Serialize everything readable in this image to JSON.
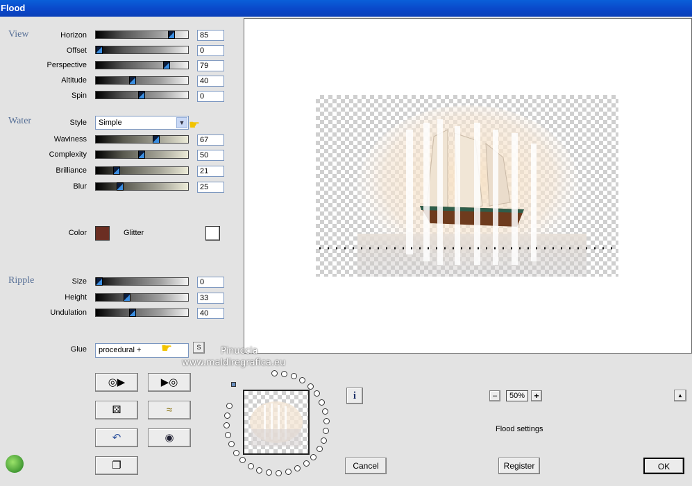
{
  "window": {
    "title": "Flood"
  },
  "sections": {
    "view": "View",
    "water": "Water",
    "ripple": "Ripple"
  },
  "view": {
    "horizon": {
      "label": "Horizon",
      "value": "85"
    },
    "offset": {
      "label": "Offset",
      "value": "0"
    },
    "perspective": {
      "label": "Perspective",
      "value": "79"
    },
    "altitude": {
      "label": "Altitude",
      "value": "40"
    },
    "spin": {
      "label": "Spin",
      "value": "0"
    }
  },
  "water": {
    "style": {
      "label": "Style",
      "value": "Simple"
    },
    "waviness": {
      "label": "Waviness",
      "value": "67"
    },
    "complexity": {
      "label": "Complexity",
      "value": "50"
    },
    "brilliance": {
      "label": "Brilliance",
      "value": "21"
    },
    "blur": {
      "label": "Blur",
      "value": "25"
    },
    "color_label": "Color",
    "color": "#6b2e22",
    "glitter_label": "Glitter",
    "glitter_color": "#ffffff"
  },
  "ripple": {
    "size": {
      "label": "Size",
      "value": "0"
    },
    "height": {
      "label": "Height",
      "value": "33"
    },
    "undulation": {
      "label": "Undulation",
      "value": "40"
    }
  },
  "glue": {
    "label": "Glue",
    "value": "procedural +",
    "s_button": "S"
  },
  "watermark": {
    "line1": "Pinuccia",
    "line2": "www.maldiregrafica.eu"
  },
  "zoom": {
    "value": "50%",
    "minus": "–",
    "plus": "+"
  },
  "status": {
    "settings_label": "Flood settings"
  },
  "buttons": {
    "cancel": "Cancel",
    "register": "Register",
    "ok": "OK",
    "info": "i",
    "up": "▲"
  },
  "icons": {
    "load": "reel-arrow-left-icon",
    "save": "reel-arrow-right-icon",
    "random": "dice-icon",
    "wave": "wave-icon",
    "undo": "undo-icon",
    "reset": "ring-icon",
    "copy": "copy-icon",
    "logo": "app-logo-icon"
  }
}
